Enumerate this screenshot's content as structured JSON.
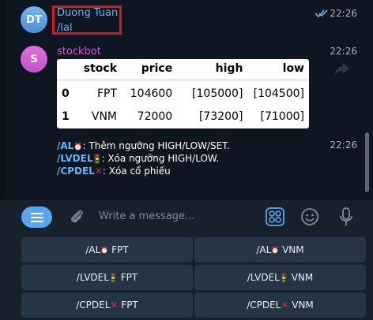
{
  "messages": [
    {
      "avatar_initials": "DT",
      "sender": "Duong Tuan",
      "text": "/lal",
      "time": "22:26"
    },
    {
      "avatar_initials": "S",
      "sender": "stockbot",
      "time": "22:26",
      "table": {
        "headers": [
          "",
          "stock",
          "price",
          "high",
          "low"
        ],
        "rows": [
          [
            "0",
            "FPT",
            "104600",
            "[105000]",
            "[104500]"
          ],
          [
            "1",
            "VNM",
            "72000",
            "[73200]",
            "[71000]"
          ]
        ]
      }
    },
    {
      "time": "22:26",
      "lines": [
        {
          "cmd": "/AL",
          "emoji": "⏰",
          "text": ": Thêm ngưỡng HIGH/LOW/SET."
        },
        {
          "cmd": "/LVDEL",
          "emoji": "🚦",
          "text": ": Xóa ngưỡng HIGH/LOW."
        },
        {
          "cmd": "/CPDEL",
          "emoji": "❌",
          "text": ": Xóa cổ phiếu"
        }
      ]
    }
  ],
  "composer": {
    "placeholder": "Write a message..."
  },
  "keyboard": {
    "buttons": [
      {
        "cmd": "/AL",
        "emoji": "⏰",
        "ticker": "FPT"
      },
      {
        "cmd": "/AL",
        "emoji": "⏰",
        "ticker": "VNM"
      },
      {
        "cmd": "/LVDEL",
        "emoji": "🚦",
        "ticker": "FPT"
      },
      {
        "cmd": "/LVDEL",
        "emoji": "🚦",
        "ticker": "VNM"
      },
      {
        "cmd": "/CPDEL",
        "emoji": "❌",
        "ticker": "FPT"
      },
      {
        "cmd": "/CPDEL",
        "emoji": "❌",
        "ticker": "VNM"
      }
    ]
  },
  "colors": {
    "background": "#0e1621",
    "link": "#6ab2f2",
    "highlight_box": "#e0141e",
    "stockbot_name": "#d65ad1"
  }
}
